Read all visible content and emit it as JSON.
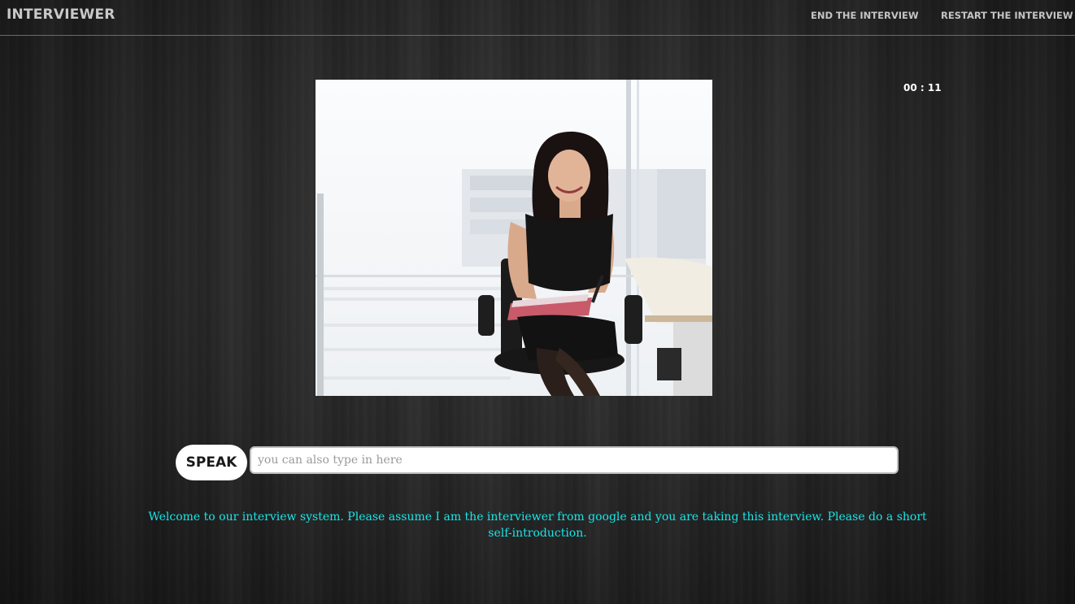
{
  "navbar": {
    "brand": "INTERVIEWER",
    "links": {
      "end": "END THE INTERVIEW",
      "restart": "RESTART THE INTERVIEW"
    }
  },
  "timer": {
    "text": "00 : 11"
  },
  "interviewer_photo": {
    "icon": "interviewer-photo"
  },
  "input_bar": {
    "speak_label": "SPEAK",
    "input_value": "",
    "input_placeholder": "you can also type in here"
  },
  "message": {
    "text": "Welcome to our interview system. Please assume I am the interviewer from google and you are taking this interview. Please do a short self-introduction."
  },
  "colors": {
    "message": "#19e5e8",
    "nav_text": "#c4c4c4",
    "background": "#262626"
  }
}
